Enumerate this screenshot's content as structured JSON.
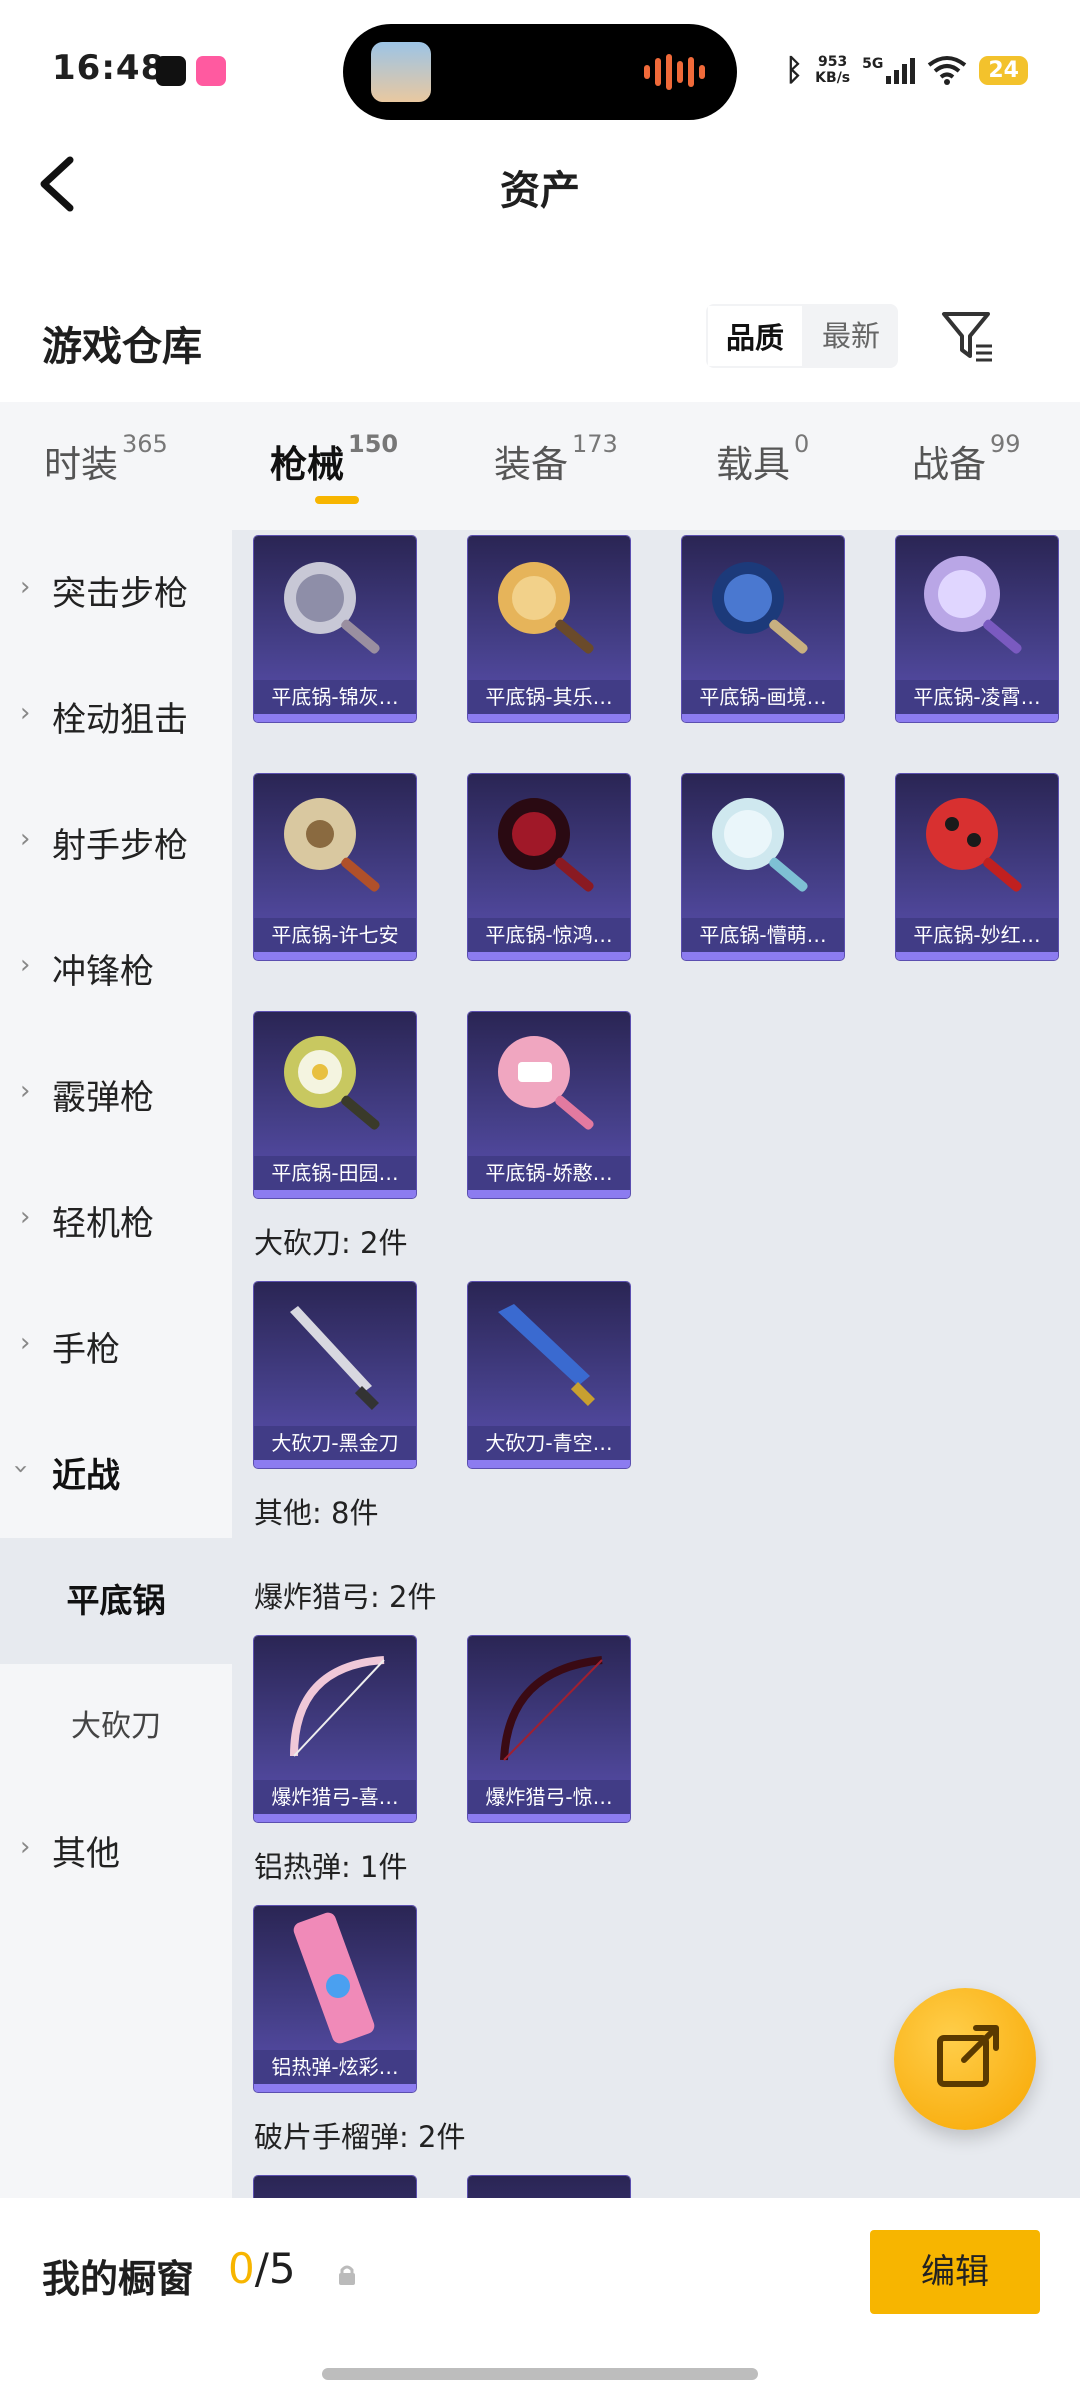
{
  "status": {
    "time": "16:48",
    "net_speed": "953",
    "net_unit": "KB/s",
    "signal": "5G",
    "battery": "24"
  },
  "header": {
    "title": "资产"
  },
  "section": {
    "title": "游戏仓库",
    "sort_quality": "品质",
    "sort_newest": "最新"
  },
  "tabs": [
    {
      "label": "时装",
      "count": "365"
    },
    {
      "label": "枪械",
      "count": "150"
    },
    {
      "label": "装备",
      "count": "173"
    },
    {
      "label": "载具",
      "count": "0"
    },
    {
      "label": "战备",
      "count": "99"
    }
  ],
  "sidebar": {
    "items": [
      "突击步枪",
      "栓动狙击",
      "射手步枪",
      "冲锋枪",
      "霰弹枪",
      "轻机枪",
      "手枪",
      "近战"
    ],
    "sub_active": "平底锅",
    "sub_other": "大砍刀",
    "other": "其他"
  },
  "items": {
    "pan": [
      "平底锅-锦灰…",
      "平底锅-其乐…",
      "平底锅-画境…",
      "平底锅-凌霄…",
      "平底锅-许七安",
      "平底锅-惊鸿…",
      "平底锅-懵萌…",
      "平底锅-妙红…",
      "平底锅-田园…",
      "平底锅-娇憨…"
    ],
    "machete_label": "大砍刀: 2件",
    "machete": [
      "大砍刀-黑金刀",
      "大砍刀-青空…"
    ],
    "other_label": "其他: 8件",
    "bow_label": "爆炸猎弓: 2件",
    "bow": [
      "爆炸猎弓-喜…",
      "爆炸猎弓-惊…"
    ],
    "thermite_label": "铝热弹: 1件",
    "thermite": [
      "铝热弹-炫彩…"
    ],
    "frag_label": "破片手榴弹: 2件"
  },
  "bottom": {
    "title": "我的橱窗",
    "count_current": "0",
    "count_total": "/5",
    "edit": "编辑"
  },
  "colors": {
    "accent": "#f7b500",
    "card_bg": "#46408a"
  }
}
